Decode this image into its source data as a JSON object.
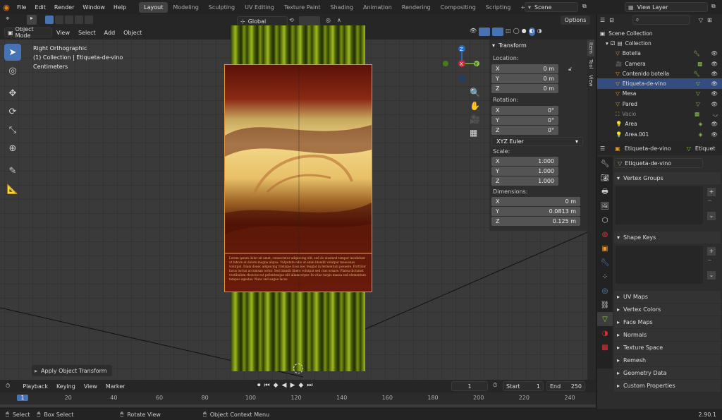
{
  "topbar": {
    "menus": [
      "File",
      "Edit",
      "Render",
      "Window",
      "Help"
    ],
    "workspaces": [
      "Layout",
      "Modeling",
      "Sculpting",
      "UV Editing",
      "Texture Paint",
      "Shading",
      "Animation",
      "Rendering",
      "Compositing",
      "Scripting"
    ],
    "scene": "Scene",
    "view_layer": "View Layer",
    "plus": "+"
  },
  "viewport_header": {
    "mode": "Object Mode",
    "menus": [
      "View",
      "Select",
      "Add",
      "Object"
    ],
    "transform_orient": "Global",
    "options": "Options"
  },
  "viewport": {
    "view_name": "Right Orthographic",
    "collection": "(1) Collection | Etiqueta-de-vino",
    "units": "Centimeters",
    "last_op": "Apply Object Transform",
    "gizmo": {
      "x": "X",
      "y": "Y",
      "z": "Z"
    },
    "label_text": "Lorem ipsum dolor sit amet, consectetur adipiscing elit, sed do eiusmod tempor incididunt ut labore et dolore magna aliqua. Vulputate odio ut enim blandit volutpat maecenas volutpat. Diam donec adipiscing tristique risus nec feugiat in fermentum posuere. Porttitor lacus luctus accumsan tortor. Sed blandit libero volutpat sed cras ornare. Platea dictumst vestibulum rhoncus est pellentesque elit ullamcorper. In vitae turpis massa sed elementum tempus egestas. Nunc sed augue lacus"
  },
  "npanel": {
    "title": "Transform",
    "location_label": "Location:",
    "location": [
      {
        "axis": "X",
        "value": "0 m"
      },
      {
        "axis": "Y",
        "value": "0 m"
      },
      {
        "axis": "Z",
        "value": "0 m"
      }
    ],
    "rotation_label": "Rotation:",
    "rotation": [
      {
        "axis": "X",
        "value": "0°"
      },
      {
        "axis": "Y",
        "value": "0°"
      },
      {
        "axis": "Z",
        "value": "0°"
      }
    ],
    "rotation_mode": "XYZ Euler",
    "scale_label": "Scale:",
    "scale": [
      {
        "axis": "X",
        "value": "1.000"
      },
      {
        "axis": "Y",
        "value": "1.000"
      },
      {
        "axis": "Z",
        "value": "1.000"
      }
    ],
    "dimensions_label": "Dimensions:",
    "dimensions": [
      {
        "axis": "X",
        "value": "0 m"
      },
      {
        "axis": "Y",
        "value": "0.0813 m"
      },
      {
        "axis": "Z",
        "value": "0.125 m"
      }
    ],
    "tabs": [
      "Item",
      "Tool",
      "View"
    ]
  },
  "outliner": {
    "root": "Scene Collection",
    "collection": "Collection",
    "items": [
      {
        "name": "Botella",
        "selected": false,
        "dim": false
      },
      {
        "name": "Camera",
        "selected": false,
        "dim": false
      },
      {
        "name": "Contenido botella",
        "selected": false,
        "dim": false
      },
      {
        "name": "Etiqueta-de-vino",
        "selected": true,
        "dim": false
      },
      {
        "name": "Mesa",
        "selected": false,
        "dim": false
      },
      {
        "name": "Pared",
        "selected": false,
        "dim": false
      },
      {
        "name": "Vacio",
        "selected": false,
        "dim": true
      },
      {
        "name": "Area",
        "selected": false,
        "dim": false
      },
      {
        "name": "Area.001",
        "selected": false,
        "dim": false
      }
    ]
  },
  "properties": {
    "object_name": "Etiqueta-de-vino",
    "data_tab": "Etiquet",
    "mesh_name": "Etiqueta-de-vino",
    "panels": [
      "Vertex Groups",
      "Shape Keys",
      "UV Maps",
      "Vertex Colors",
      "Face Maps",
      "Normals",
      "Texture Space",
      "Remesh",
      "Geometry Data",
      "Custom Properties"
    ]
  },
  "timeline": {
    "menus": [
      "Playback",
      "Keying",
      "View",
      "Marker"
    ],
    "current_frame": "1",
    "start_label": "Start",
    "start": "1",
    "end_label": "End",
    "end": "250",
    "ticks": [
      "1",
      "20",
      "40",
      "60",
      "80",
      "100",
      "120",
      "140",
      "160",
      "180",
      "200",
      "220",
      "240"
    ]
  },
  "statusbar": {
    "select": "Select",
    "box_select": "Box Select",
    "rotate": "Rotate View",
    "context": "Object Context Menu",
    "version": "2.90.1"
  },
  "colors": {
    "accent": "#4772b3",
    "label_border": "#e8962a",
    "bottle_green": "#6f8a12"
  }
}
